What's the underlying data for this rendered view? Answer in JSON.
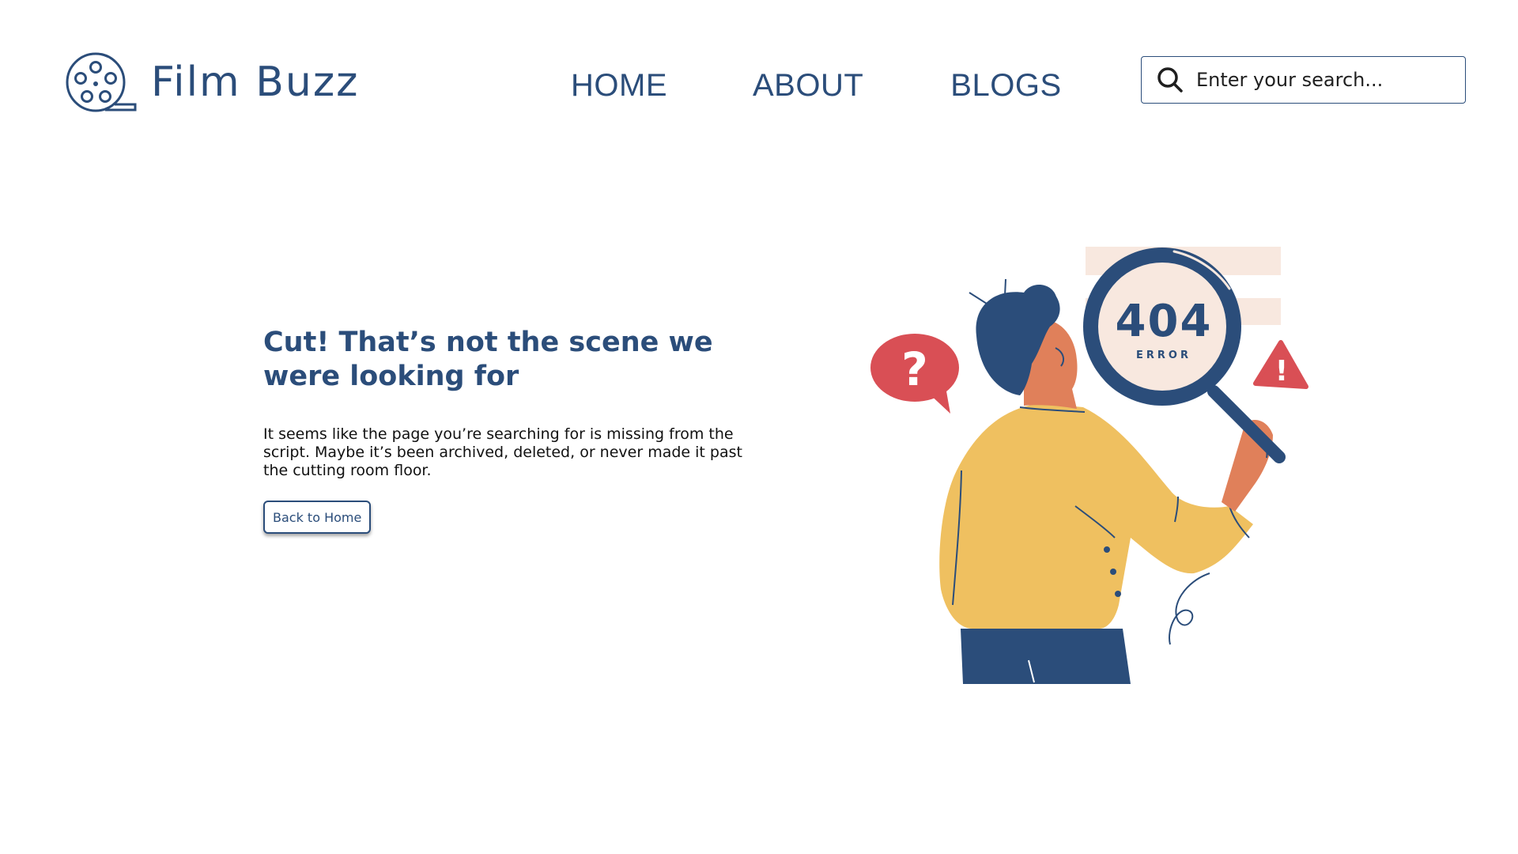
{
  "brand": {
    "name": "Film Buzz",
    "logo_icon": "film-reel-icon"
  },
  "nav": {
    "items": [
      {
        "label": "HOME"
      },
      {
        "label": "ABOUT"
      },
      {
        "label": "BLOGS"
      }
    ]
  },
  "search": {
    "placeholder": "Enter your search...",
    "value": "",
    "icon": "search-icon"
  },
  "main": {
    "headline": "Cut! That’s not the scene we were looking for",
    "message": "It seems like the page you’re searching for is missing from the script. Maybe it’s been archived, deleted, or never made it past the cutting room floor.",
    "back_button": "Back to Home"
  },
  "illustration": {
    "code": "404",
    "code_label": "ERROR",
    "question_mark": "?",
    "alert_mark": "!"
  },
  "colors": {
    "primary": "#2b4d7a",
    "sweater": "#efc060",
    "skin": "#e0805a",
    "accent_red": "#d94f55",
    "pale_peach": "#f8e8df"
  }
}
